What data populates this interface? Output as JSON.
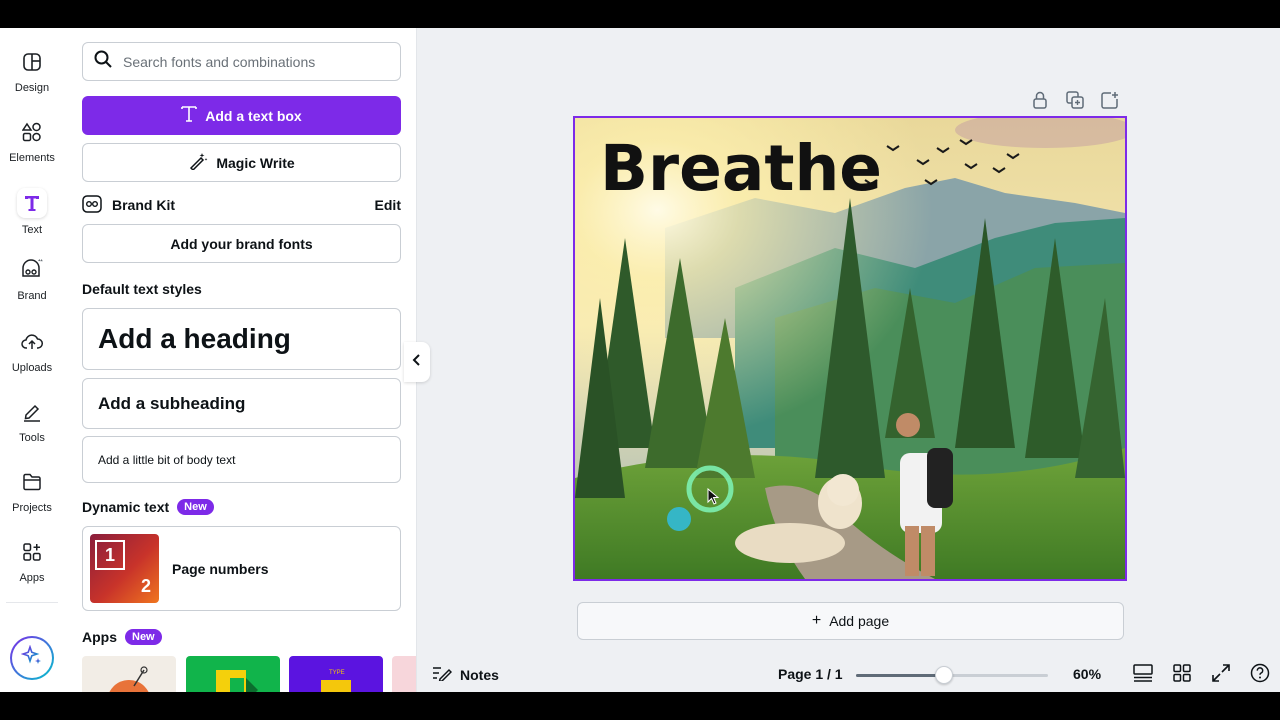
{
  "rail": {
    "items": [
      {
        "label": "Design",
        "icon": "design-icon"
      },
      {
        "label": "Elements",
        "icon": "elements-icon"
      },
      {
        "label": "Text",
        "icon": "text-icon"
      },
      {
        "label": "Brand",
        "icon": "brand-icon"
      },
      {
        "label": "Uploads",
        "icon": "uploads-icon"
      },
      {
        "label": "Tools",
        "icon": "tools-icon"
      },
      {
        "label": "Projects",
        "icon": "projects-icon"
      },
      {
        "label": "Apps",
        "icon": "apps-icon"
      }
    ],
    "active": "Text",
    "magic_icon": "sparkle-icon"
  },
  "panel": {
    "search_placeholder": "Search fonts and combinations",
    "add_text_box": "Add a text box",
    "magic_write": "Magic Write",
    "brand_kit": "Brand Kit",
    "brand_edit": "Edit",
    "add_brand_fonts": "Add your brand fonts",
    "default_styles_title": "Default text styles",
    "heading": "Add a heading",
    "subheading": "Add a subheading",
    "body": "Add a little bit of body text",
    "dynamic_title": "Dynamic text",
    "new_badge": "New",
    "page_numbers": "Page numbers",
    "page_numbers_thumb": [
      "1",
      "2"
    ],
    "apps_title": "Apps",
    "apps_badge": "New"
  },
  "canvas": {
    "headline": "Breathe",
    "add_page": "Add page",
    "accent": "#7d2ae8"
  },
  "footer": {
    "notes": "Notes",
    "page_indicator": "Page 1 / 1",
    "zoom_label": "60%",
    "zoom_value": 0.46
  }
}
